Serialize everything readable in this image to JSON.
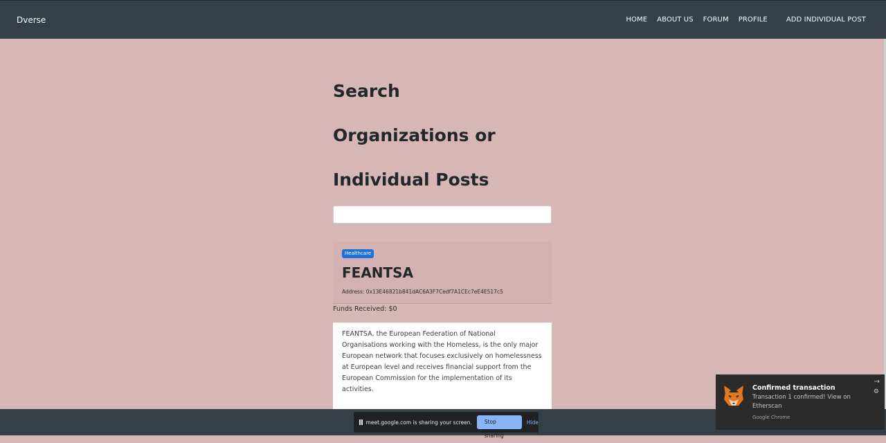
{
  "navbar": {
    "brand": "Dverse",
    "links": [
      "HOME",
      "ABOUT US",
      "FORUM",
      "PROFILE",
      "ADD INDIVIDUAL POST"
    ]
  },
  "search": {
    "title_lines": [
      "Search",
      "Organizations or",
      "Individual Posts"
    ],
    "input_value": ""
  },
  "organization": {
    "category": "Healthcare",
    "name": "FEANTSA",
    "address_label": "Address:",
    "address": "0x13E46821b841dAC6A3F7Cedf7A1CEc7eE4E517c5",
    "funds_label": "Funds Received:",
    "funds_value": "$0",
    "description": "FEANTSA, the European Federation of National Organisations working with the Homeless, is the only major European network that focuses exclusively on homelessness at European level and receives financial support from the European Commission for the implementation of its activities."
  },
  "screen_share": {
    "message": "meet.google.com is sharing your screen.",
    "stop_label": "Stop sharing",
    "hide_label": "Hide"
  },
  "notification": {
    "title": "Confirmed transaction",
    "body": "Transaction 1 confirmed! View on Etherscan",
    "source": "Google Chrome",
    "icon": "metamask-fox-icon"
  },
  "colors": {
    "background": "#d7b7b6",
    "navbar": "#343f48",
    "badge": "#1f72d4",
    "card_header": "#d3b0b1"
  }
}
